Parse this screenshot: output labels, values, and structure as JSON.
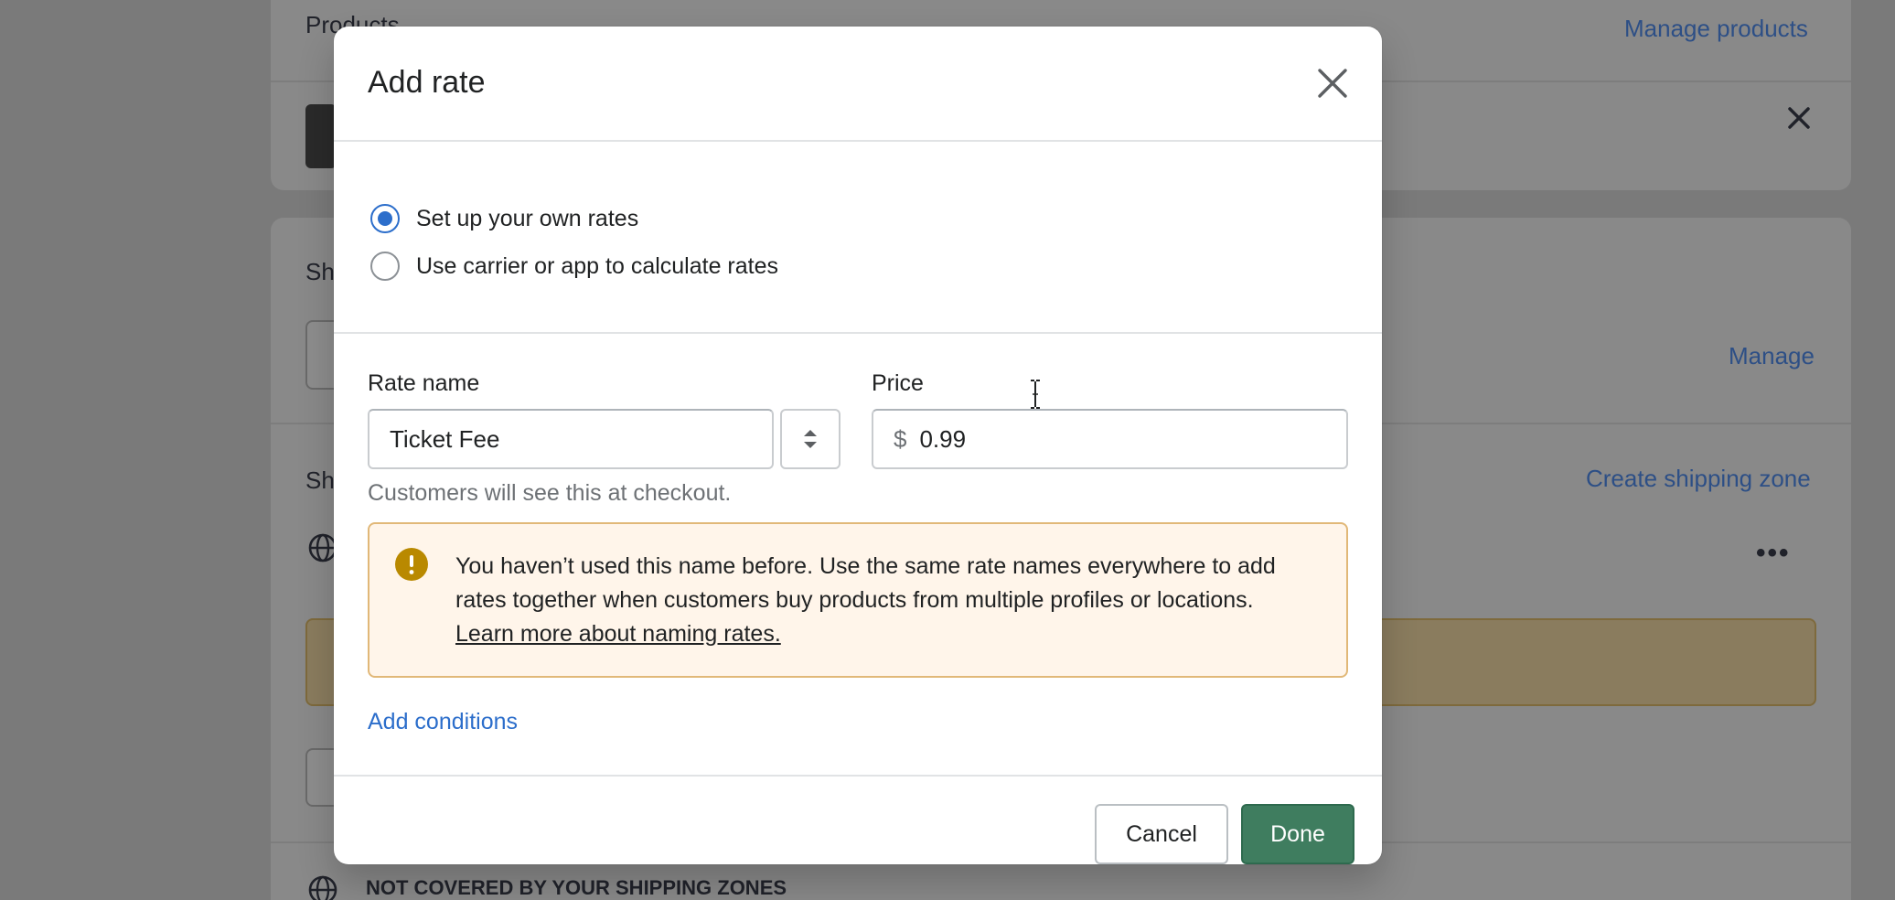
{
  "background": {
    "products_title": "Products",
    "manage_products": "Manage products",
    "section_sh1": "Sh",
    "manage": "Manage",
    "section_sh2": "Sh",
    "create_shipping_zone": "Create shipping zone",
    "more_dots": "•••",
    "not_covered": "NOT COVERED BY YOUR SHIPPING ZONES"
  },
  "modal": {
    "title": "Add rate",
    "radios": [
      {
        "label": "Set up your own rates",
        "checked": true
      },
      {
        "label": "Use carrier or app to calculate rates",
        "checked": false
      }
    ],
    "rate_name": {
      "label": "Rate name",
      "value": "Ticket Fee",
      "help": "Customers will see this at checkout."
    },
    "price": {
      "label": "Price",
      "prefix": "$",
      "value": "0.99"
    },
    "banner": {
      "text": "You haven’t used this name before. Use the same rate names everywhere to add rates together when customers buy products from multiple profiles or locations. ",
      "link": "Learn more about naming rates."
    },
    "add_conditions": "Add conditions",
    "footer": {
      "cancel": "Cancel",
      "done": "Done"
    }
  },
  "colors": {
    "primary_green": "#3f7d5f",
    "link_blue": "#2c6ecb",
    "warning_bg": "#fff5ea",
    "warning_border": "#e1b878",
    "warning_icon": "#b98900"
  }
}
